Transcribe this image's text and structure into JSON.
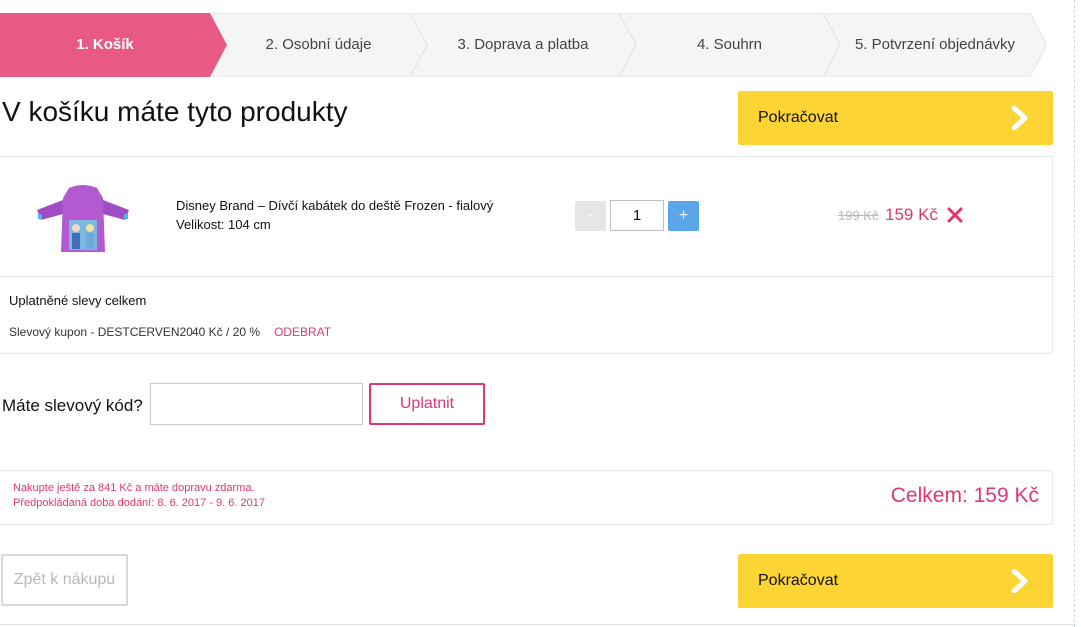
{
  "steps": [
    {
      "label": "1. Košík",
      "active": true
    },
    {
      "label": "2. Osobní údaje",
      "active": false
    },
    {
      "label": "3. Doprava a platba",
      "active": false
    },
    {
      "label": "4. Souhrn",
      "active": false
    },
    {
      "label": "5. Potvrzení objednávky",
      "active": false
    }
  ],
  "page": {
    "title": "V košíku máte tyto produkty",
    "continue_label": "Pokračovat",
    "back_label": "Zpět k nákupu"
  },
  "cart": {
    "item": {
      "name": "Disney Brand – Dívčí kabátek do deště Frozen - fialový",
      "size": "Velikost: 104 cm",
      "quantity": "1",
      "minus": "-",
      "plus": "+",
      "price_old": "199 Kč",
      "price_new": "159 Kč",
      "icon": "close-icon"
    }
  },
  "discounts": {
    "title": "Uplatněné slevy celkem",
    "coupon": "Slevový kupon - DESTCERVEN20",
    "value": "40 Kč / 20 %",
    "remove_label": "ODEBRAT"
  },
  "coupon_form": {
    "label": "Máte slevový kód?",
    "placeholder": "",
    "apply_label": "Uplatnit"
  },
  "summary": {
    "shipping_note": "Nakupte ještě za 841 Kč a máte dopravu zdarma.",
    "delivery_note": "Předpokládaná doba dodání: 8. 6. 2017 - 9. 6. 2017",
    "total": "Celkem: 159 Kč"
  },
  "colors": {
    "accent": "#e0386d",
    "button": "#fcd535",
    "plus": "#5aa6e8"
  }
}
